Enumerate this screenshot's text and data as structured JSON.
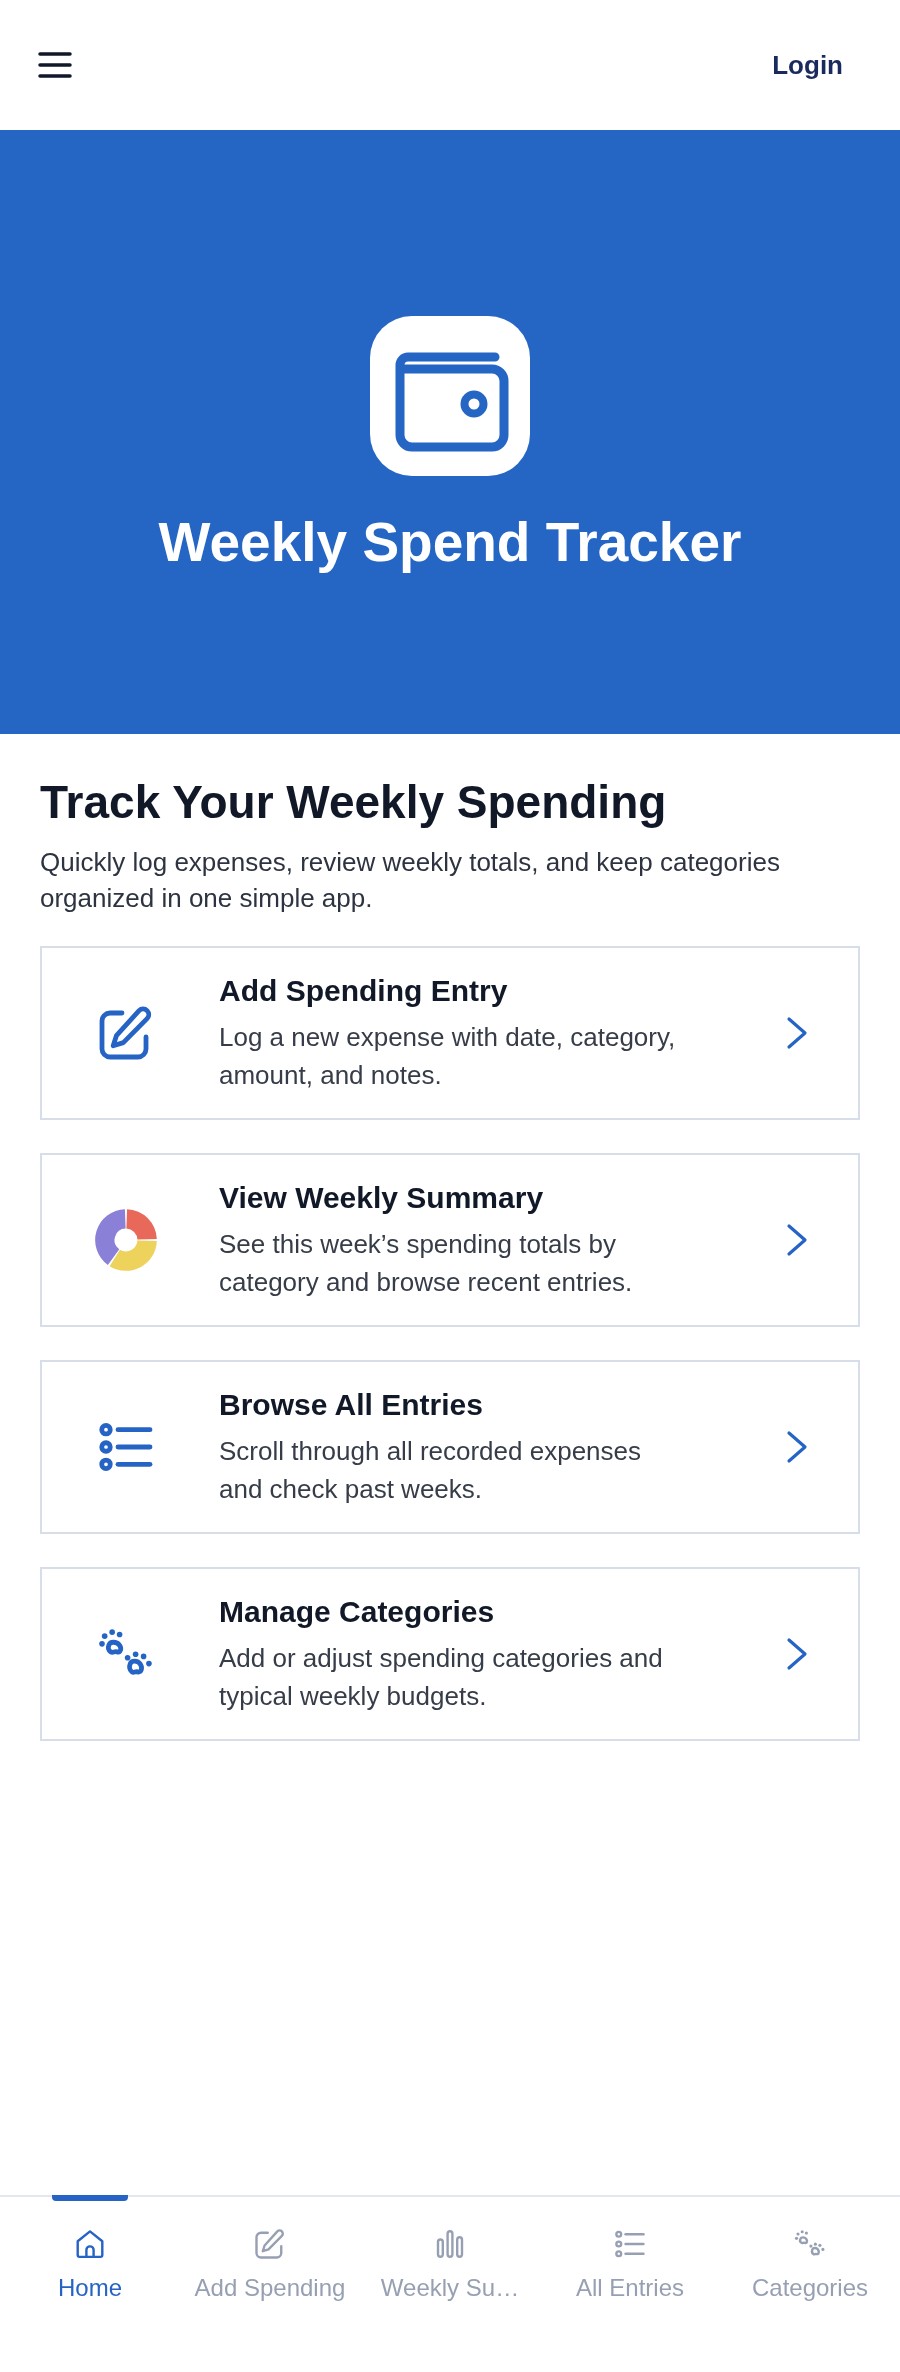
{
  "top_bar": {
    "login": "Login"
  },
  "hero": {
    "title": "Weekly Spend Tracker"
  },
  "intro": {
    "heading": "Track Your Weekly Spending",
    "text": "Quickly log expenses, review weekly totals, and keep categories organized in one simple app."
  },
  "cards": [
    {
      "kind": "edit",
      "title": "Add Spending Entry",
      "description": "Log a new expense with date, category, amount, and notes."
    },
    {
      "kind": "donut",
      "title": "View Weekly Summary",
      "description": "See this week’s spending totals by category and browse recent entries."
    },
    {
      "kind": "list",
      "title": "Browse All Entries",
      "description": "Scroll through all recorded expenses and check past weeks."
    },
    {
      "kind": "paws",
      "title": "Manage Categories",
      "description": "Add or adjust spending categories and typical weekly budgets."
    }
  ],
  "bottom_nav": [
    {
      "kind": "home",
      "label": "Home",
      "selected": true
    },
    {
      "kind": "edit",
      "label": "Add Spending",
      "selected": false
    },
    {
      "kind": "bars",
      "label": "Weekly Su…",
      "selected": false
    },
    {
      "kind": "list",
      "label": "All Entries",
      "selected": false
    },
    {
      "kind": "paws",
      "label": "Categories",
      "selected": false
    }
  ]
}
